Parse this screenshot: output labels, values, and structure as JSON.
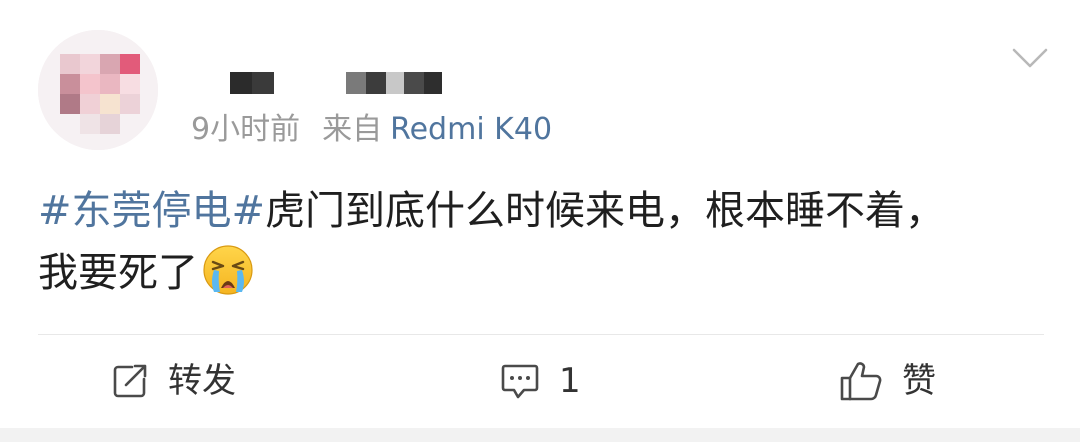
{
  "post": {
    "meta": {
      "time": "9小时前",
      "source_prefix": "来自",
      "device": "Redmi K40"
    },
    "text": {
      "hashtag": "#东莞停电#",
      "line1_rest": "虎门到底什么时候来电，根本睡不着，",
      "line2": "我要死了"
    },
    "emoji": "crying-face-emoji"
  },
  "actions": {
    "repost_label": "转发",
    "comment_count": "1",
    "like_label": "赞"
  },
  "colors": {
    "link": "#50759e",
    "meta_gray": "#9a9a9a",
    "text": "#1f1f1f",
    "divider": "#e8e8e8",
    "icon": "#4a4a4a"
  },
  "icons": {
    "menu": "chevron-down-icon",
    "repost": "repost-icon",
    "comment": "comment-icon",
    "like": "thumbs-up-icon"
  }
}
